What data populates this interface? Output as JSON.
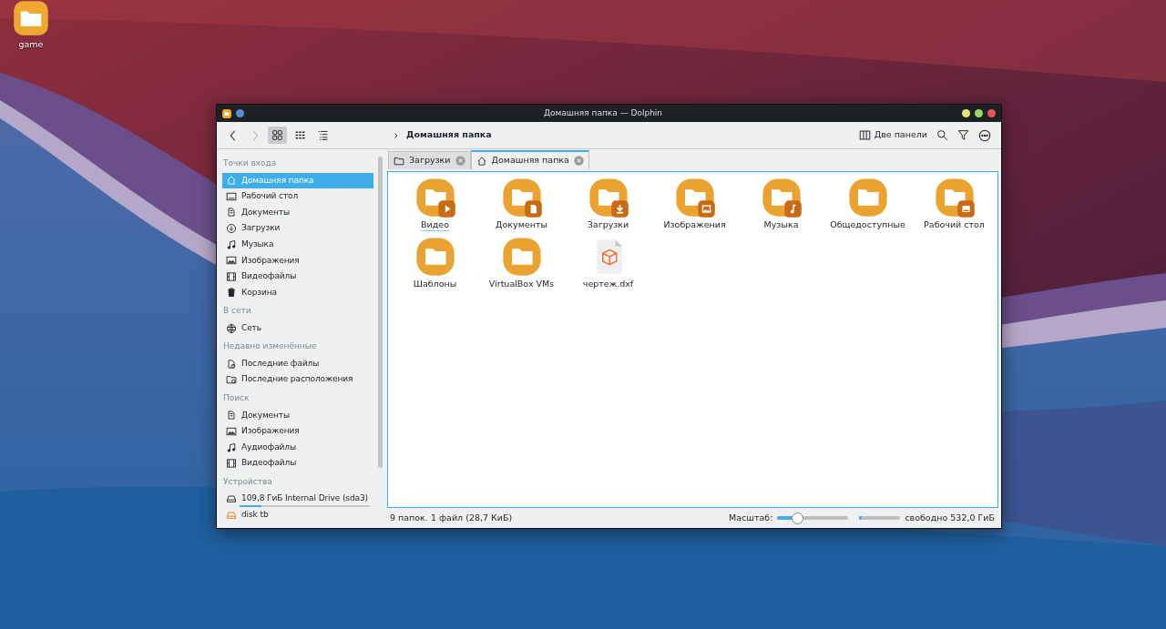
{
  "desktop": {
    "icons": [
      {
        "label": "game"
      }
    ]
  },
  "window": {
    "title": "Домашняя папка — Dolphin"
  },
  "toolbar": {
    "view_modes": [
      {
        "kind": "icons",
        "selected": true
      },
      {
        "kind": "compact",
        "selected": false
      },
      {
        "kind": "details",
        "selected": false
      }
    ],
    "breadcrumb": "Домашняя папка",
    "split_button": "Две панели"
  },
  "tabs": [
    {
      "label": "Загрузки",
      "kind": "folder",
      "selected": false
    },
    {
      "label": "Домашняя папка",
      "kind": "home",
      "selected": true
    }
  ],
  "sidebar": {
    "sections": [
      {
        "title": "Точки входа",
        "items": [
          {
            "label": "Домашняя папка",
            "kind": "home",
            "selected": true
          },
          {
            "label": "Рабочий стол",
            "kind": "desktop",
            "selected": false
          },
          {
            "label": "Документы",
            "kind": "documents",
            "selected": false
          },
          {
            "label": "Загрузки",
            "kind": "downloads",
            "selected": false
          },
          {
            "label": "Музыка",
            "kind": "music",
            "selected": false
          },
          {
            "label": "Изображения",
            "kind": "images",
            "selected": false
          },
          {
            "label": "Видеофайлы",
            "kind": "video",
            "selected": false
          },
          {
            "label": "Корзина",
            "kind": "trash",
            "selected": false
          }
        ]
      },
      {
        "title": "В сети",
        "items": [
          {
            "label": "Сеть",
            "kind": "network",
            "selected": false
          }
        ]
      },
      {
        "title": "Недавно изменённые",
        "items": [
          {
            "label": "Последние файлы",
            "kind": "recent-files",
            "selected": false
          },
          {
            "label": "Последние расположения",
            "kind": "recent-places",
            "selected": false
          }
        ]
      },
      {
        "title": "Поиск",
        "items": [
          {
            "label": "Документы",
            "kind": "documents",
            "selected": false
          },
          {
            "label": "Изображения",
            "kind": "images",
            "selected": false
          },
          {
            "label": "Аудиофайлы",
            "kind": "music",
            "selected": false
          },
          {
            "label": "Видеофайлы",
            "kind": "video",
            "selected": false
          }
        ]
      },
      {
        "title": "Устройства",
        "items": [
          {
            "label": "109,8 ГиБ Internal Drive (sda3)",
            "kind": "drive",
            "selected": false,
            "level": 0.17
          },
          {
            "label": "disk tb",
            "kind": "removable",
            "selected": false
          }
        ]
      }
    ]
  },
  "files": [
    {
      "name": "Видео",
      "kind": "videos",
      "focused": true
    },
    {
      "name": "Документы",
      "kind": "documents",
      "focused": false
    },
    {
      "name": "Загрузки",
      "kind": "downloads",
      "focused": false
    },
    {
      "name": "Изображения",
      "kind": "pictures",
      "focused": false
    },
    {
      "name": "Музыка",
      "kind": "music",
      "focused": false
    },
    {
      "name": "Общедоступные",
      "kind": "folder",
      "focused": false
    },
    {
      "name": "Рабочий стол",
      "kind": "desktop",
      "focused": false
    },
    {
      "name": "Шаблоны",
      "kind": "folder",
      "focused": false
    },
    {
      "name": "VirtualBox VMs",
      "kind": "folder",
      "focused": false
    },
    {
      "name": "чертеж.dxf",
      "kind": "cad",
      "focused": false
    }
  ],
  "status_bar": {
    "summary": "9 папок. 1 файл (28,7 КиБ)",
    "zoom_label": "Масштаб:",
    "zoom": {
      "level": 0.28
    },
    "free_space": {
      "level": 0.06
    },
    "free_text": "свободно 532,0 ГиБ"
  }
}
